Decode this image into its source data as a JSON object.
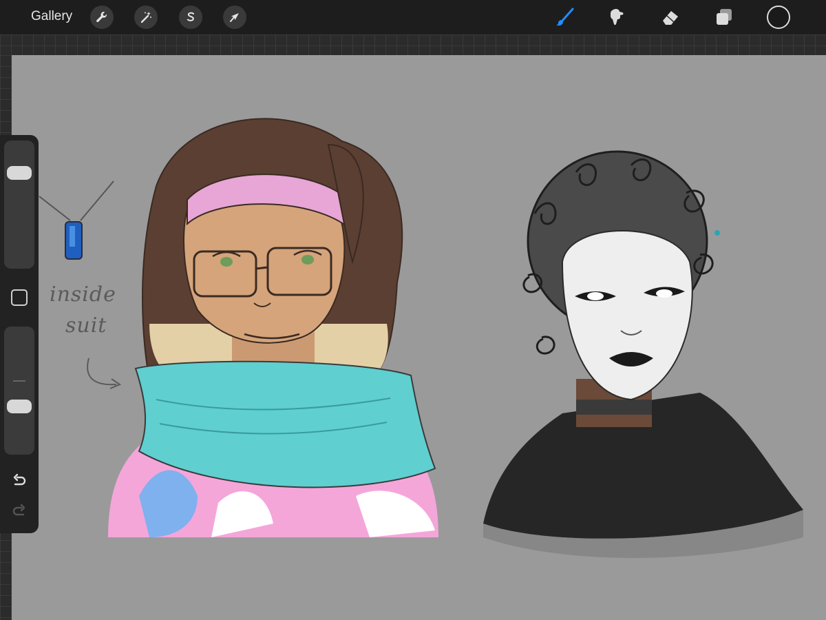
{
  "toolbar": {
    "gallery_label": "Gallery",
    "left_tools": [
      "wrench-icon",
      "magic-wand-icon",
      "selection-s-icon",
      "transform-arrow-icon"
    ],
    "right_tools": [
      "brush-icon",
      "smudge-icon",
      "eraser-icon",
      "layers-icon"
    ],
    "active_tool": "brush-icon",
    "active_color": "#1a1a1a",
    "accent_color": "#1f8fff"
  },
  "sidebar": {
    "brush_size": 0.2,
    "opacity": 0.65,
    "modify_icon": "square-icon",
    "undo_icon": "undo-icon",
    "redo_icon": "redo-icon"
  },
  "canvas": {
    "background_color": "#9a9a9a",
    "annotation_text": [
      "inside",
      "suit"
    ]
  }
}
